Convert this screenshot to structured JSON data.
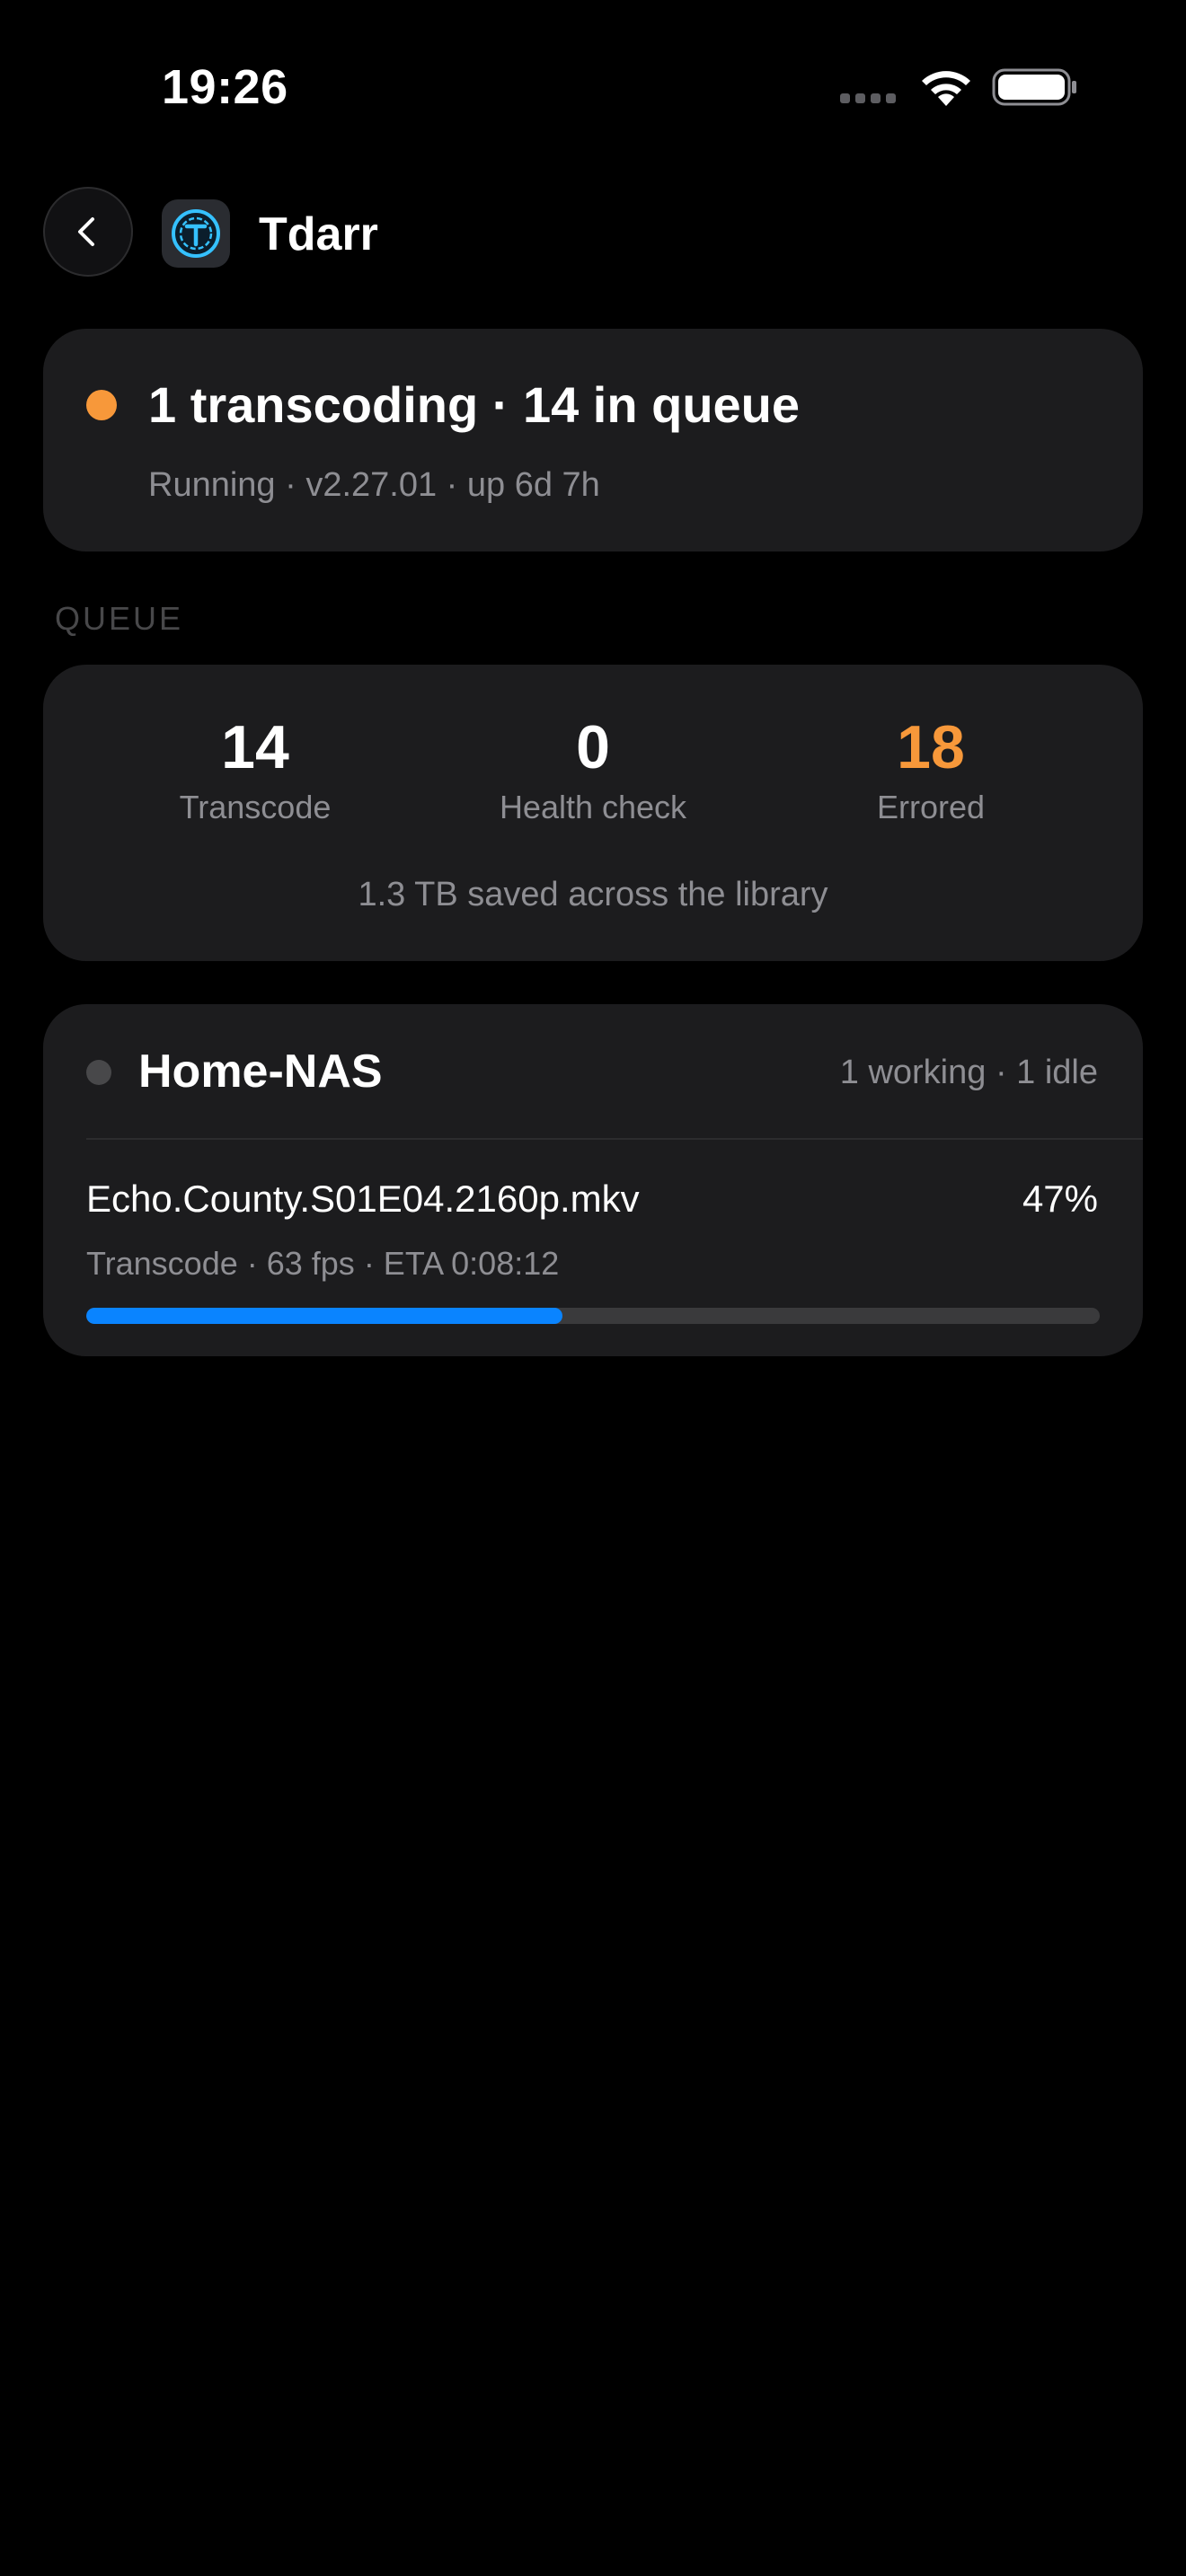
{
  "status_bar": {
    "time": "19:26"
  },
  "header": {
    "title": "Tdarr",
    "back_icon": "chevron-left-icon",
    "logo_icon": "tdarr-logo-icon"
  },
  "summary": {
    "headline": "1 transcoding · 14 in queue",
    "subtitle": "Running · v2.27.01 · up 6d 7h",
    "status_color": "#f7983a"
  },
  "queue": {
    "section_label": "QUEUE",
    "stats": [
      {
        "value": "14",
        "label": "Transcode",
        "color": "#ffffff"
      },
      {
        "value": "0",
        "label": "Health check",
        "color": "#ffffff"
      },
      {
        "value": "18",
        "label": "Errored",
        "color": "#f7983a"
      }
    ],
    "footnote": "1.3 TB saved across the library"
  },
  "node": {
    "name": "Home-NAS",
    "status_color": "#48484a",
    "summary": "1 working · 1 idle",
    "job": {
      "filename": "Echo.County.S01E04.2160p.mkv",
      "percent_label": "47%",
      "details": "Transcode · 63 fps · ETA 0:08:12",
      "progress": 0.47,
      "progress_color": "#0a84ff"
    }
  },
  "colors": {
    "background": "#000000",
    "card": "#1c1c1e",
    "secondary_text": "#8e8e93",
    "accent_orange": "#f7983a",
    "accent_blue": "#0a84ff"
  }
}
